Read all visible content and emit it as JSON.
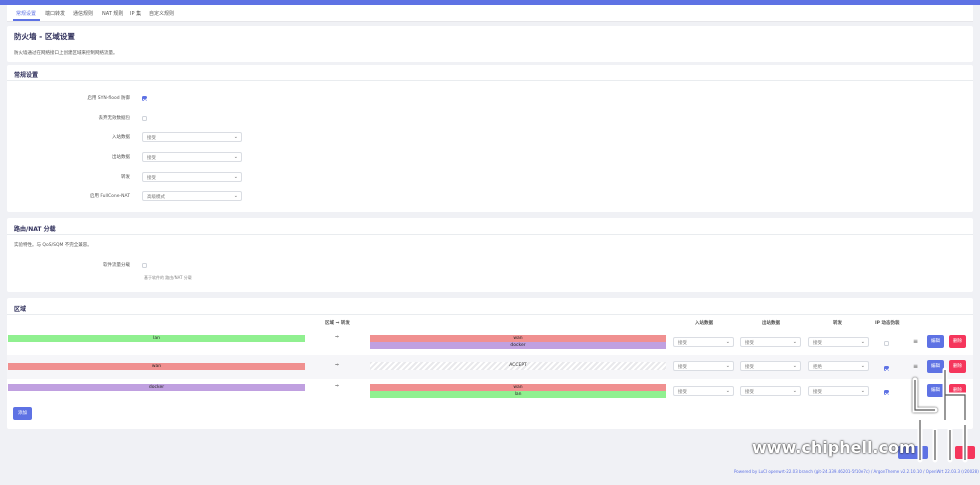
{
  "tabs": [
    "常规设置",
    "端口转发",
    "通信规则",
    "NAT 规则",
    "IP 集",
    "自定义规则"
  ],
  "page": {
    "title": "防火墙 - 区域设置",
    "description": "防火墙通过在网络接口上创建区域来控制网络流量。"
  },
  "general": {
    "title": "常规设置",
    "syn_flood_label": "启用 SYN-flood 防御",
    "drop_invalid_label": "丢弃无效数据包",
    "input_label": "入站数据",
    "input_value": "接受",
    "output_label": "出站数据",
    "output_value": "接受",
    "forward_label": "转发",
    "forward_value": "接受",
    "fullcone_label": "启用 FullCone-NAT",
    "fullcone_value": "高级模式"
  },
  "offload": {
    "title": "路由/NAT 分载",
    "description": "实验特性。与 QoS/SQM 不完全兼容。",
    "software_label": "软件流量分载",
    "software_hint": "基于软件的 路由/NAT 分载"
  },
  "zones": {
    "title": "区域",
    "headers": {
      "zone_forward": "区域 ⇒ 转发",
      "input": "入站数据",
      "output": "出站数据",
      "forward": "转发",
      "ip_dynamic": "IP 动态伪装"
    },
    "rows": [
      {
        "name": "lan",
        "color": "#90f090",
        "arrow": "⇒",
        "targets": [
          {
            "name": "wan",
            "color": "#f09090"
          },
          {
            "name": "docker",
            "color": "#c0a0e0"
          }
        ],
        "input": "接受",
        "output": "接受",
        "forward": "接受",
        "masq": false
      },
      {
        "name": "wan",
        "color": "#f09090",
        "arrow": "⇒",
        "targets": [
          {
            "name": "ACCEPT",
            "color": "hatch"
          }
        ],
        "input": "接受",
        "output": "接受",
        "forward": "拒绝",
        "masq": true
      },
      {
        "name": "docker",
        "color": "#c0a0e0",
        "arrow": "⇒",
        "targets": [
          {
            "name": "wan",
            "color": "#f09090"
          },
          {
            "name": "lan",
            "color": "#90f090"
          }
        ],
        "input": "接受",
        "output": "接受",
        "forward": "接受",
        "masq": true
      }
    ],
    "edit_label": "编辑",
    "delete_label": "删除",
    "add_label": "添加"
  },
  "footer": {
    "text": "Powered by LuCI openwrt-22.03 branch (git-24.339.46201-5f10e7c) / ArgonTheme v2.2.10.10 / OpenWrt 22.03.3 (r20028)",
    "watermark": "www.chiphell.com"
  }
}
